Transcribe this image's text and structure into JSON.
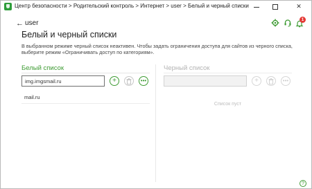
{
  "window": {
    "title": "Центр безопасности > Родительский контроль > Интернет > user > Белый и черный списки"
  },
  "toolbar": {
    "notification_count": "1",
    "icons": [
      "settings-gear-icon",
      "support-headset-icon",
      "notifications-bell-icon"
    ]
  },
  "nav": {
    "back_label": "user"
  },
  "page": {
    "title": "Белый и черный списки",
    "description": "В выбранном режиме черный список неактивен. Чтобы задать ограничения доступа для сайтов из черного списка, выберите режим «Ограничивать доступ по категориям»."
  },
  "whitelist": {
    "title": "Белый список",
    "input_value": "img.imgsmail.ru",
    "items": [
      "mail.ru"
    ]
  },
  "blacklist": {
    "title": "Черный список",
    "input_value": "",
    "empty_text": "Список пуст"
  },
  "colors": {
    "accent": "#3e9b33",
    "badge": "#e53935",
    "disabled": "#bdbdbd"
  }
}
